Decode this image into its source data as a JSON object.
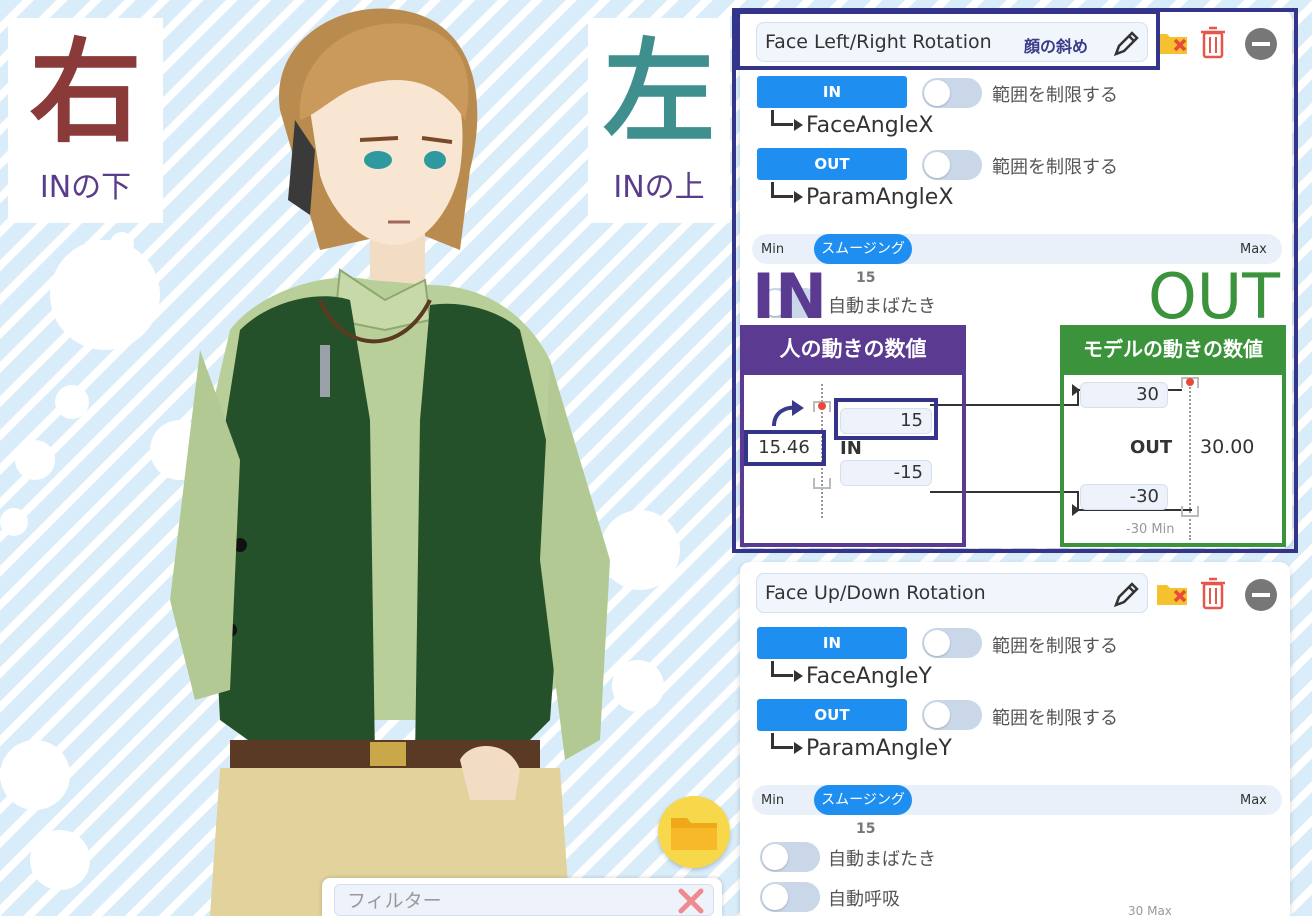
{
  "labels": {
    "right_kanji": "右",
    "right_sub": "INの下",
    "left_kanji": "左",
    "left_sub": "INの上",
    "big_in": "IN",
    "big_out": "OUT",
    "human_values": "人の動きの数値",
    "model_values": "モデルの動きの数値"
  },
  "panel1": {
    "name": "Face Left/Right Rotation",
    "alias": "顔の斜め",
    "in_label": "IN",
    "out_label": "OUT",
    "limit_label": "範囲を制限する",
    "in_param": "FaceAngleX",
    "out_param": "ParamAngleX",
    "slider_min": "Min",
    "slider_max": "Max",
    "smoothing_label": "スムージング",
    "smoothing_value": "15",
    "auto_blink": "自動まばたき",
    "in_current": "15.46",
    "in_max": "15",
    "in_min": "-15",
    "in_axis": "IN",
    "out_max": "30",
    "out_min": "-30",
    "out_axis": "OUT",
    "out_current": "30.00",
    "out_min_caption": "-30 Min"
  },
  "panel2": {
    "name": "Face Up/Down Rotation",
    "in_label": "IN",
    "out_label": "OUT",
    "limit_label": "範囲を制限する",
    "in_param": "FaceAngleY",
    "out_param": "ParamAngleY",
    "slider_min": "Min",
    "slider_max": "Max",
    "smoothing_label": "スムージング",
    "smoothing_value": "15",
    "auto_blink": "自動まばたき",
    "auto_breath": "自動呼吸",
    "bottom_caption": "30 Max"
  },
  "filter": {
    "placeholder": "フィルター"
  },
  "colors": {
    "accent": "#1e8ff0",
    "annotation_navy": "#34348a",
    "annotation_purple": "#5b3a92",
    "annotation_green": "#3b933b",
    "right_kanji": "#8b3a3a",
    "left_kanji": "#3f8f8f"
  },
  "icons": [
    "pencil-icon",
    "folder-delete-icon",
    "trash-icon",
    "minus-circle-icon",
    "folder-icon",
    "close-icon"
  ]
}
